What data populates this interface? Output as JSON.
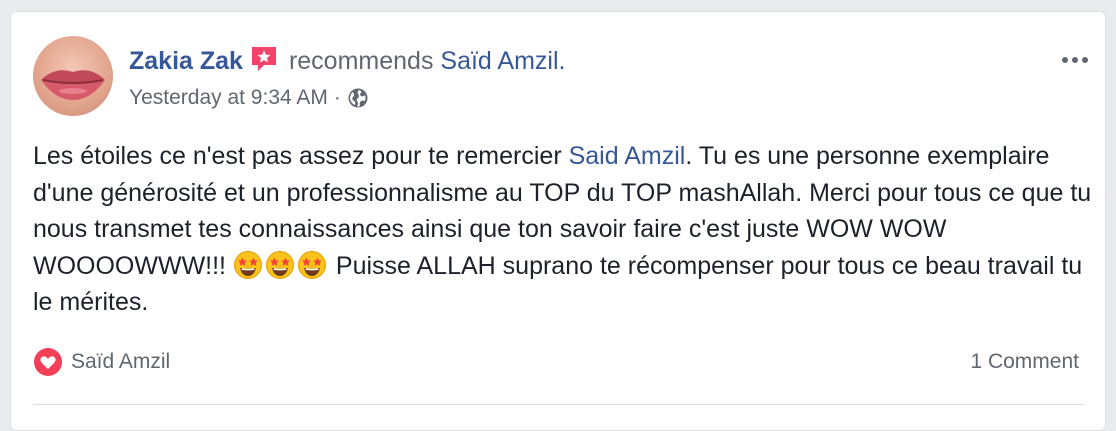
{
  "post": {
    "author": "Zakia Zak",
    "action": "recommends",
    "target": "Saïd Amzil.",
    "timestamp": "Yesterday at 9:34 AM",
    "separator": "·",
    "privacy_icon": "globe-icon",
    "author_badge_icon": "recommendation-star-icon",
    "body": {
      "part1": "Les étoiles ce n'est pas assez pour te remercier ",
      "mention": "Said Amzil",
      "part2": ". Tu es une personne exemplaire d'une générosité et un professionnalisme au TOP du TOP mashAllah. Merci pour tous ce que tu nous transmet tes connaissances ainsi que ton savoir faire c'est juste WOW WOW WOOOOWWW!!! ",
      "emoji": [
        "star-struck-emoji",
        "star-struck-emoji",
        "star-struck-emoji"
      ],
      "part3": " Puisse ALLAH suprano te récompenser pour tous ce beau travail tu le mérites."
    }
  },
  "footer": {
    "reaction_icon": "heart-icon",
    "reactor": "Saïd Amzil",
    "comments": "1 Comment"
  },
  "colors": {
    "link": "#365899",
    "secondary_text": "#606770",
    "badge": "#f5436b",
    "heart": "#f33e58"
  }
}
